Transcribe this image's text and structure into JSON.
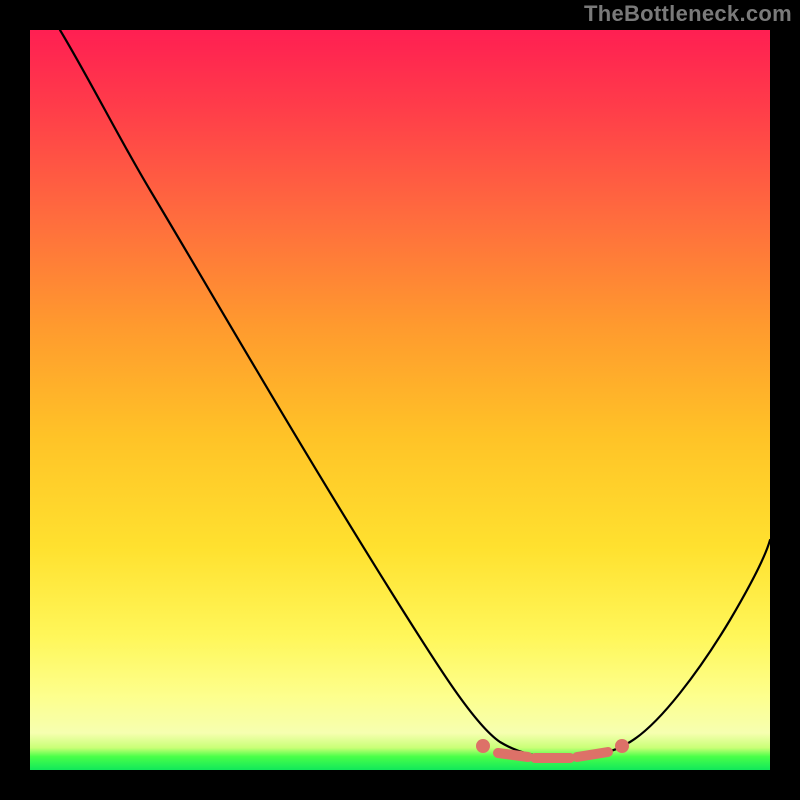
{
  "watermark": "TheBottleneck.com",
  "colors": {
    "background": "#000000",
    "marker": "#dd7168",
    "curve": "#000000",
    "top_gradient": "#ff1f52",
    "bottom_gradient": "#11e85b"
  },
  "chart_data": {
    "type": "line",
    "title": "",
    "xlabel": "",
    "ylabel": "",
    "xlim": [
      0,
      100
    ],
    "ylim": [
      0,
      100
    ],
    "grid": false,
    "legend": false,
    "series": [
      {
        "name": "bottleneck-curve",
        "x": [
          0,
          6,
          12,
          18,
          24,
          30,
          36,
          42,
          48,
          54,
          59,
          62,
          65,
          68,
          71,
          74,
          77,
          80,
          83,
          86,
          89,
          92,
          95,
          98,
          100
        ],
        "y": [
          100,
          93,
          85,
          77,
          69,
          61,
          53,
          45,
          37,
          29,
          21,
          15,
          10,
          6,
          3,
          2,
          2,
          2,
          3,
          6,
          10,
          15,
          22,
          30,
          36
        ],
        "notes": "V-shaped curve. Steep near-linear descent from top-left, broad flat minimum around x≈72-80, then rises toward the right edge."
      }
    ],
    "markers": {
      "description": "Salmon-colored pill-shaped segment tracing the flat bottom of the V, with small round caps at both ends.",
      "x_range": [
        62,
        83
      ],
      "y_level": 2
    }
  }
}
